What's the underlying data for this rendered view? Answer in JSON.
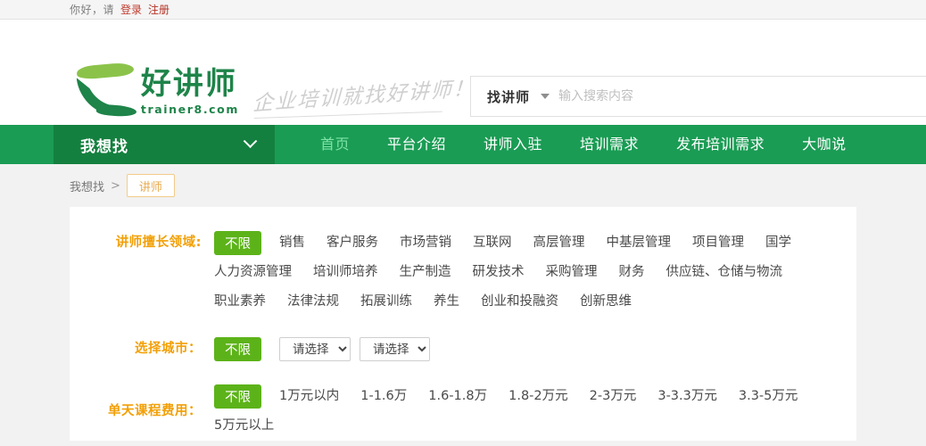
{
  "topbar": {
    "greeting": "你好，请",
    "login": "登录",
    "register": "注册"
  },
  "logo": {
    "cn": "好讲师",
    "en": "trainer8.com",
    "slogan": "企业培训就找好讲师！"
  },
  "search": {
    "category": "找讲师",
    "placeholder": "输入搜索内容",
    "value": ""
  },
  "nav": {
    "dropdown_label": "我想找",
    "items": [
      {
        "label": "首页",
        "active": true
      },
      {
        "label": "平台介绍",
        "active": false
      },
      {
        "label": "讲师入驻",
        "active": false
      },
      {
        "label": "培训需求",
        "active": false
      },
      {
        "label": "发布培训需求",
        "active": false
      },
      {
        "label": "大咖说",
        "active": false
      }
    ]
  },
  "breadcrumb": {
    "root": "我想找",
    "separator": ">",
    "tag": "讲师"
  },
  "filters": {
    "field": {
      "label": "讲师擅长领域:",
      "all": "不限",
      "options": [
        "销售",
        "客户服务",
        "市场营销",
        "互联网",
        "高层管理",
        "中基层管理",
        "项目管理",
        "国学",
        "人力资源管理",
        "培训师培养",
        "生产制造",
        "研发技术",
        "采购管理",
        "财务",
        "供应链、仓储与物流",
        "职业素养",
        "法律法规",
        "拓展训练",
        "养生",
        "创业和投融资",
        "创新思维"
      ]
    },
    "city": {
      "label": "选择城市：",
      "all": "不限",
      "province_value": "请选择",
      "city_value": "请选择",
      "province_options": [
        "请选择"
      ],
      "city_options": [
        "请选择"
      ]
    },
    "fee": {
      "label": "单天课程费用：",
      "all": "不限",
      "options": [
        "1万元以内",
        "1-1.6万",
        "1.6-1.8万",
        "1.8-2万元",
        "2-3万元",
        "3-3.3万元",
        "3.3-5万元",
        "5万元以上"
      ]
    }
  },
  "colors": {
    "nav_green": "#1a9c54",
    "nav_dropdown_green": "#14803f",
    "active_nav": "#7fe3a8",
    "chip_green": "#5cb319",
    "label_orange": "#f2a007",
    "tag_orange": "#e8ab4e",
    "link_red": "#c0392b",
    "logo_green": "#1e8449",
    "logo_light_green": "#8bc34a"
  }
}
